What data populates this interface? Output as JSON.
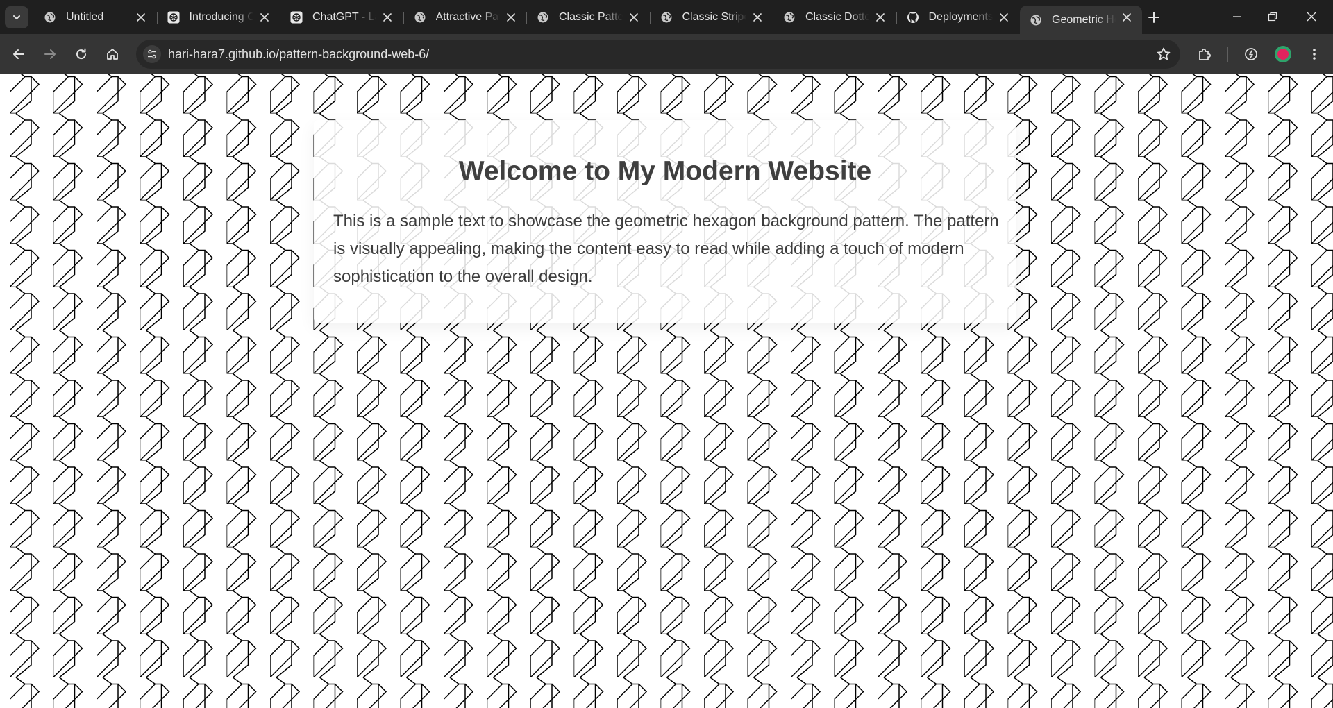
{
  "browser": {
    "tabs": [
      {
        "title": "Untitled",
        "favicon": "globe-icon",
        "active": false
      },
      {
        "title": "Introducing ChatGPT",
        "favicon": "openai-icon",
        "active": false
      },
      {
        "title": "ChatGPT - Latest",
        "favicon": "openai-icon",
        "active": false
      },
      {
        "title": "Attractive Patterns",
        "favicon": "globe-icon",
        "active": false
      },
      {
        "title": "Classic Patterns",
        "favicon": "globe-icon",
        "active": false
      },
      {
        "title": "Classic Stripes",
        "favicon": "globe-icon",
        "active": false
      },
      {
        "title": "Classic Dotted",
        "favicon": "globe-icon",
        "active": false
      },
      {
        "title": "Deployments",
        "favicon": "github-icon",
        "active": false
      },
      {
        "title": "Geometric Hexagon",
        "favicon": "globe-icon",
        "active": true
      }
    ],
    "address_bar": {
      "url": "hari-hara7.github.io/pattern-background-web-6/"
    },
    "colors": {
      "tabstrip": "#1f1f1f",
      "toolbar": "#353535",
      "omnibox": "#282828",
      "text": "#e3e3e3"
    }
  },
  "page": {
    "heading": "Welcome to My Modern Website",
    "body": "This is a sample text to showcase the geometric hexagon background pattern. The pattern is visually appealing, making the content easy to read while adding a touch of modern sophistication to the overall design.",
    "colors": {
      "background": "#ffffff",
      "pattern_stroke": "#000000",
      "heading": "#3f3f3f",
      "body_text": "#3d3d3d"
    }
  }
}
